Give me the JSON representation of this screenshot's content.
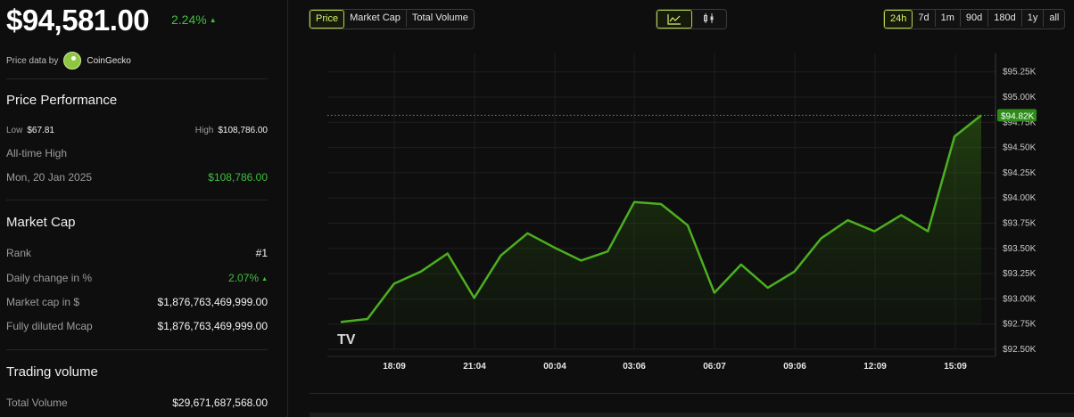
{
  "header": {
    "price": "$94,581.00",
    "change": "2.24%",
    "change_arrow": "▲",
    "source_prefix": "Price data by",
    "source_name": "CoinGecko"
  },
  "performance": {
    "title": "Price Performance",
    "low_label": "Low",
    "low_value": "$67.81",
    "high_label": "High",
    "high_value": "$108,786.00",
    "ath_label": "All-time High",
    "ath_date": "Mon, 20 Jan 2025",
    "ath_value": "$108,786.00"
  },
  "market_cap": {
    "title": "Market Cap",
    "rows": [
      {
        "label": "Rank",
        "value": "#1"
      },
      {
        "label": "Daily change in %",
        "value": "2.07%",
        "arrow": "▲"
      },
      {
        "label": "Market cap in $",
        "value": "$1,876,763,469,999.00"
      },
      {
        "label": "Fully diluted Mcap",
        "value": "$1,876,763,469,999.00"
      }
    ]
  },
  "trading_volume": {
    "title": "Trading volume",
    "rows": [
      {
        "label": "Total Volume",
        "value": "$29,671,687,568.00"
      }
    ]
  },
  "toolbar": {
    "metric_tabs": [
      "Price",
      "Market Cap",
      "Total Volume"
    ],
    "active_metric": "Price",
    "view_icons": [
      "line-chart-icon",
      "candlestick-icon"
    ],
    "ranges": [
      "24h",
      "7d",
      "1m",
      "90d",
      "180d",
      "1y",
      "all"
    ],
    "active_range": "24h"
  },
  "chart_data": {
    "type": "area",
    "title": "",
    "xlabel": "",
    "ylabel": "",
    "x_ticks": [
      "18:09",
      "21:04",
      "00:04",
      "03:06",
      "06:07",
      "09:06",
      "12:09",
      "15:09"
    ],
    "y_ticks": [
      "$92.50K",
      "$92.75K",
      "$93.00K",
      "$93.25K",
      "$93.50K",
      "$93.75K",
      "$94.00K",
      "$94.25K",
      "$94.50K",
      "$94.75K",
      "$95.00K",
      "$95.25K"
    ],
    "ylim": [
      92500,
      95300
    ],
    "series": [
      {
        "values": [
          92770,
          92800,
          93150,
          93270,
          93450,
          93010,
          93430,
          93650,
          93510,
          93380,
          93470,
          93960,
          93940,
          93730,
          93060,
          93340,
          93110,
          93270,
          93600,
          93780,
          93670,
          93830,
          93670,
          94610,
          94820
        ]
      }
    ],
    "current_value_label": "$94.82K",
    "current_value": 94820,
    "grid": true,
    "line_color": "#4caf1f",
    "accent_color": "#d6f36b",
    "watermark": "TV"
  }
}
